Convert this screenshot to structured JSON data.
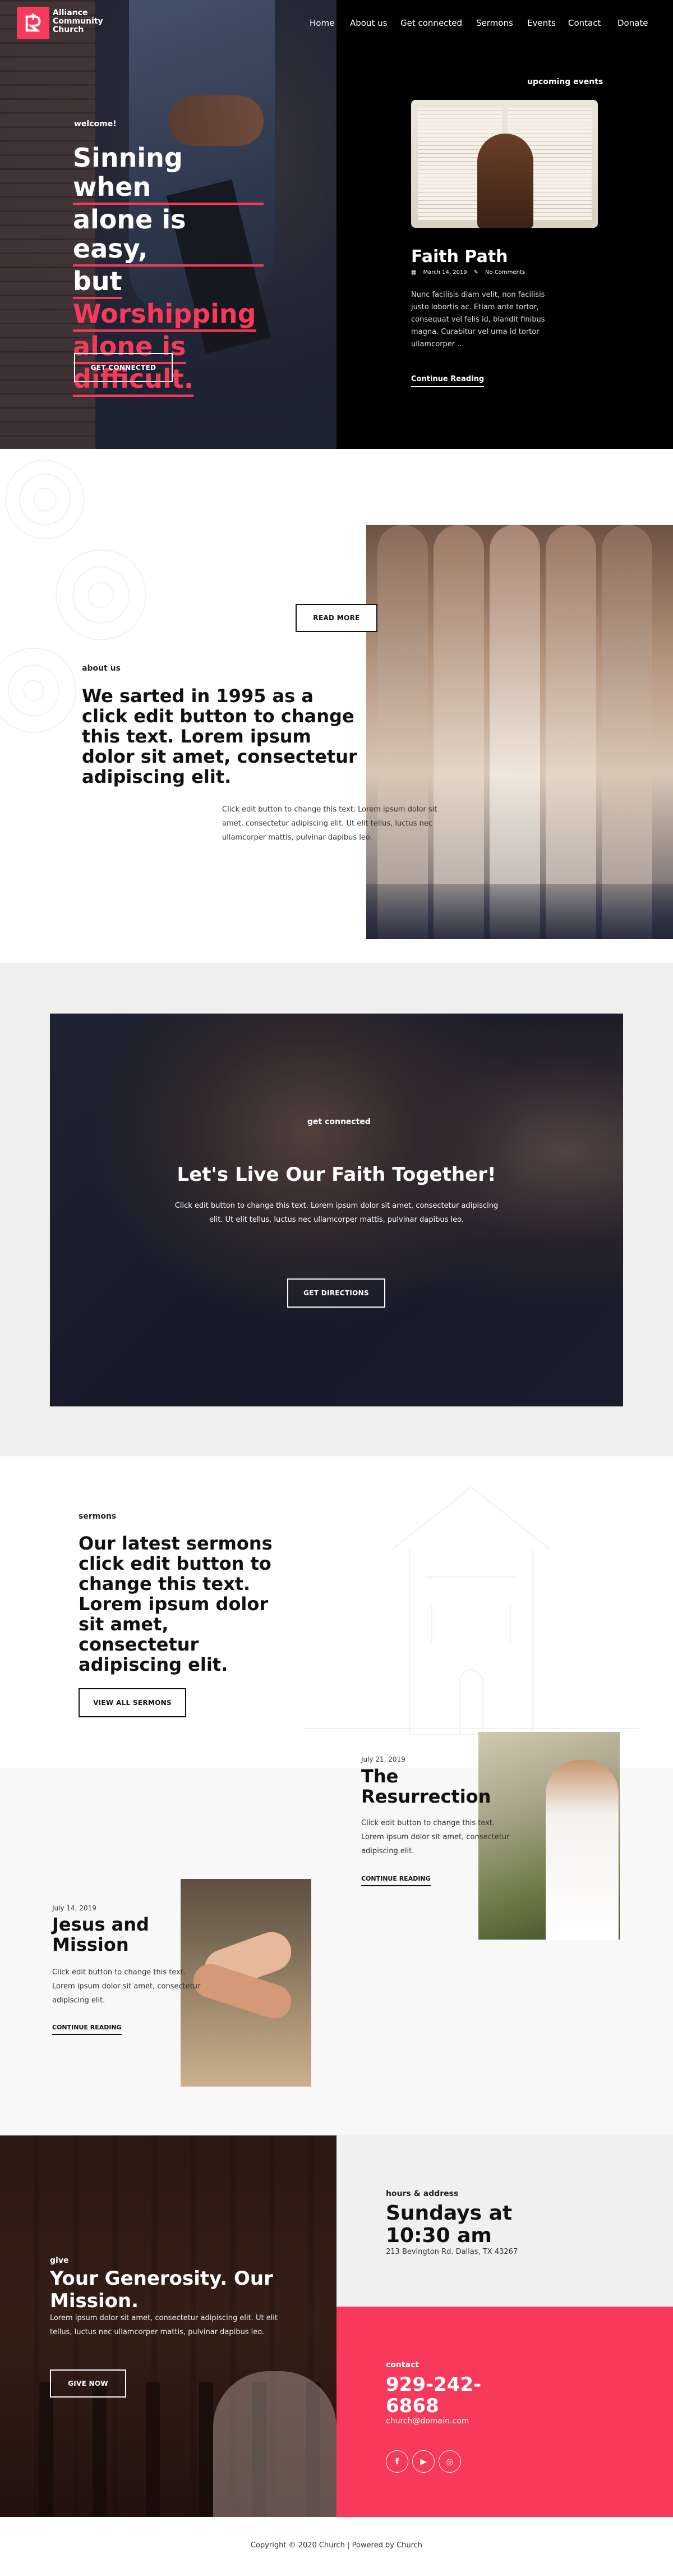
{
  "brand": {
    "name_line1": "Alliance",
    "name_line2": "Community",
    "name_line3": "Church",
    "accent": "#f73a5c"
  },
  "nav": {
    "items": [
      "Home",
      "About us",
      "Get connected",
      "Sermons",
      "Events",
      "Contact",
      "Donate"
    ],
    "active": "Home"
  },
  "hero": {
    "welcome": "welcome!",
    "title_white_1": "Sinning when",
    "title_white_2": "alone is easy,",
    "title_white_3": "but",
    "title_red_1": "Worshipping",
    "title_red_2": "alone is",
    "title_red_3": "difficult.",
    "button": "GET CONNECTED"
  },
  "event": {
    "section_label": "upcoming events",
    "image_icon": "praying-hands-bible-image",
    "title": "Faith Path",
    "date": "March 14, 2019",
    "comments": "No Comments",
    "body": "Nunc facilisis diam velit, non facilisis justo lobortis ac. Etiam ante tortor, consequat vel felis id, blandit finibus magna. Curabitur vel urna id tortor ullamcorper ...",
    "link": "Continue Reading"
  },
  "about": {
    "button": "READ MORE",
    "label": "about us",
    "title": "We sarted in 1995 as a click edit button to change this text. Lorem ipsum dolor sit amet, consectetur adipiscing elit.",
    "body": "Click edit button to change this text. Lorem ipsum dolor sit amet, consectetur adipiscing elit. Ut elit tellus, luctus nec ullamcorper mattis, pulvinar dapibus leo."
  },
  "cta": {
    "label": "get connected",
    "title": "Let's Live Our Faith Together!",
    "body": "Click edit button to change this text. Lorem ipsum dolor sit amet, consectetur adipiscing elit. Ut elit tellus, luctus nec ullamcorper mattis, pulvinar dapibus leo.",
    "button": "GET DIRECTIONS"
  },
  "sermons": {
    "label": "sermons",
    "title": "Our latest sermons click edit button to change this text. Lorem ipsum dolor sit amet, consectetur adipiscing elit.",
    "button": "VIEW ALL SERMONS",
    "posts": [
      {
        "date": "July 21, 2019",
        "title": "The Resurrection",
        "body": "Click edit button to change this text. Lorem ipsum dolor sit amet, consectetur adipiscing elit.",
        "link": "CONTINUE READING"
      },
      {
        "date": "July 14, 2019",
        "title": "Jesus and Mission",
        "body": "Click edit button to change this text. Lorem ipsum dolor sit amet, consectetur adipiscing elit.",
        "link": "CONTINUE READING"
      }
    ]
  },
  "give": {
    "label": "give",
    "title": "Your Generosity. Our Mission.",
    "body": "Lorem ipsum dolor sit amet, consectetur adipiscing elit. Ut elit tellus, luctus nec ullamcorper mattis, pulvinar dapibus leo.",
    "button": "GIVE NOW"
  },
  "hours": {
    "label": "hours & address",
    "title": "Sundays at 10:30 am",
    "address": "213 Bevington Rd. Dallas, TX 43267"
  },
  "contact": {
    "label": "contact",
    "phone": "929-242-6868",
    "email": "church@domain.com",
    "socials": [
      "facebook-icon",
      "youtube-icon",
      "instagram-icon"
    ]
  },
  "footer": {
    "text": "Copyright © 2020 Church | Powered by Church"
  }
}
